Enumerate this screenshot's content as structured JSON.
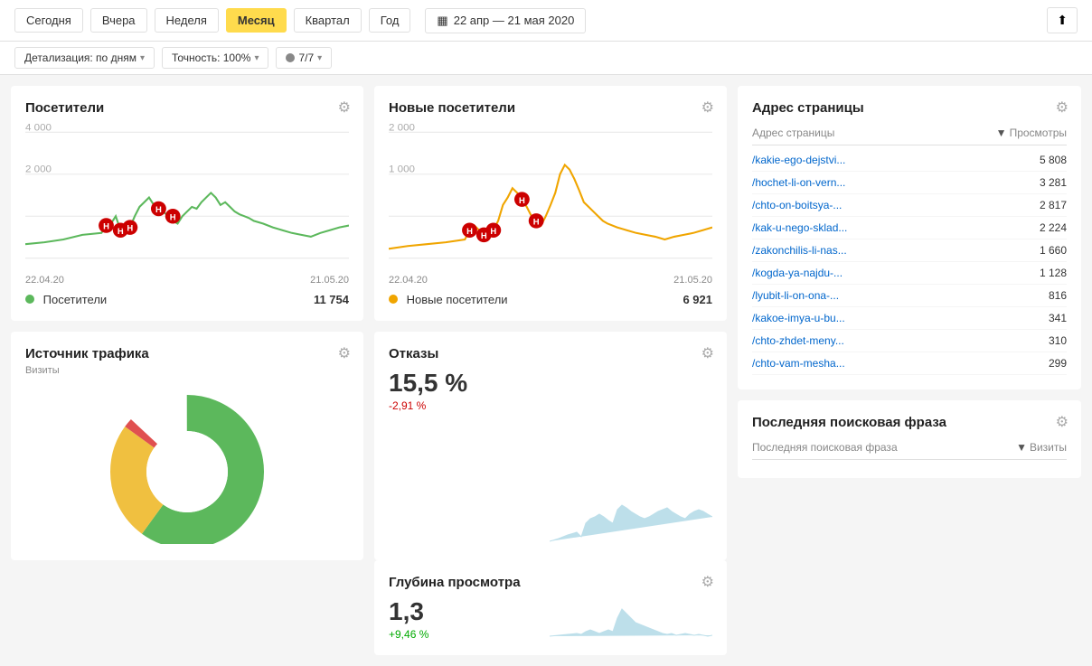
{
  "header": {
    "periods": [
      {
        "label": "Сегодня",
        "active": false
      },
      {
        "label": "Вчера",
        "active": false
      },
      {
        "label": "Неделя",
        "active": false
      },
      {
        "label": "Месяц",
        "active": true
      },
      {
        "label": "Квартал",
        "active": false
      },
      {
        "label": "Год",
        "active": false
      }
    ],
    "dateRange": "22 апр — 21 мая 2020",
    "exportLabel": "⬆"
  },
  "filters": {
    "detalization": "Детализация: по дням",
    "accuracy": "Точность: 100%",
    "segments": "7/7"
  },
  "visitors_card": {
    "title": "Посетители",
    "legend_label": "Посетители",
    "legend_value": "11 754",
    "date_start": "22.04.20",
    "date_end": "21.05.20",
    "y1": "4 000",
    "y2": "2 000"
  },
  "new_visitors_card": {
    "title": "Новые посетители",
    "legend_label": "Новые посетители",
    "legend_value": "6 921",
    "date_start": "22.04.20",
    "date_end": "21.05.20",
    "y1": "2 000",
    "y2": "1 000"
  },
  "traffic_card": {
    "title": "Источник трафика",
    "subtitle": "Визиты"
  },
  "bounce_card": {
    "title": "Отказы",
    "value": "15,5 %",
    "change": "-2,91 %",
    "change_negative": true
  },
  "depth_card": {
    "title": "Глубина просмотра",
    "value": "1,3",
    "change": "+9,46 %",
    "change_negative": false
  },
  "address_card": {
    "title": "Адрес страницы",
    "col_address": "Адрес страницы",
    "col_views": "Просмотры",
    "rows": [
      {
        "url": "/kakie-ego-dejstvi...",
        "views": "5 808"
      },
      {
        "url": "/hochet-li-on-vern...",
        "views": "3 281"
      },
      {
        "url": "/chto-on-boitsya-...",
        "views": "2 817"
      },
      {
        "url": "/kak-u-nego-sklad...",
        "views": "2 224"
      },
      {
        "url": "/zakonchilis-li-nas...",
        "views": "1 660"
      },
      {
        "url": "/kogda-ya-najdu-...",
        "views": "1 128"
      },
      {
        "url": "/lyubit-li-on-ona-...",
        "views": "816"
      },
      {
        "url": "/kakoe-imya-u-bu...",
        "views": "341"
      },
      {
        "url": "/chto-zhdet-meny...",
        "views": "310"
      },
      {
        "url": "/chto-vam-mesha...",
        "views": "299"
      }
    ]
  },
  "search_phrase_card": {
    "title": "Последняя поисковая фраза",
    "col_phrase": "Последняя поисковая фраза",
    "col_visits": "Визиты"
  },
  "icons": {
    "gear": "⚙",
    "calendar": "▦",
    "arrow_down": "▾",
    "sort_down": "▼",
    "export": "⬆"
  }
}
